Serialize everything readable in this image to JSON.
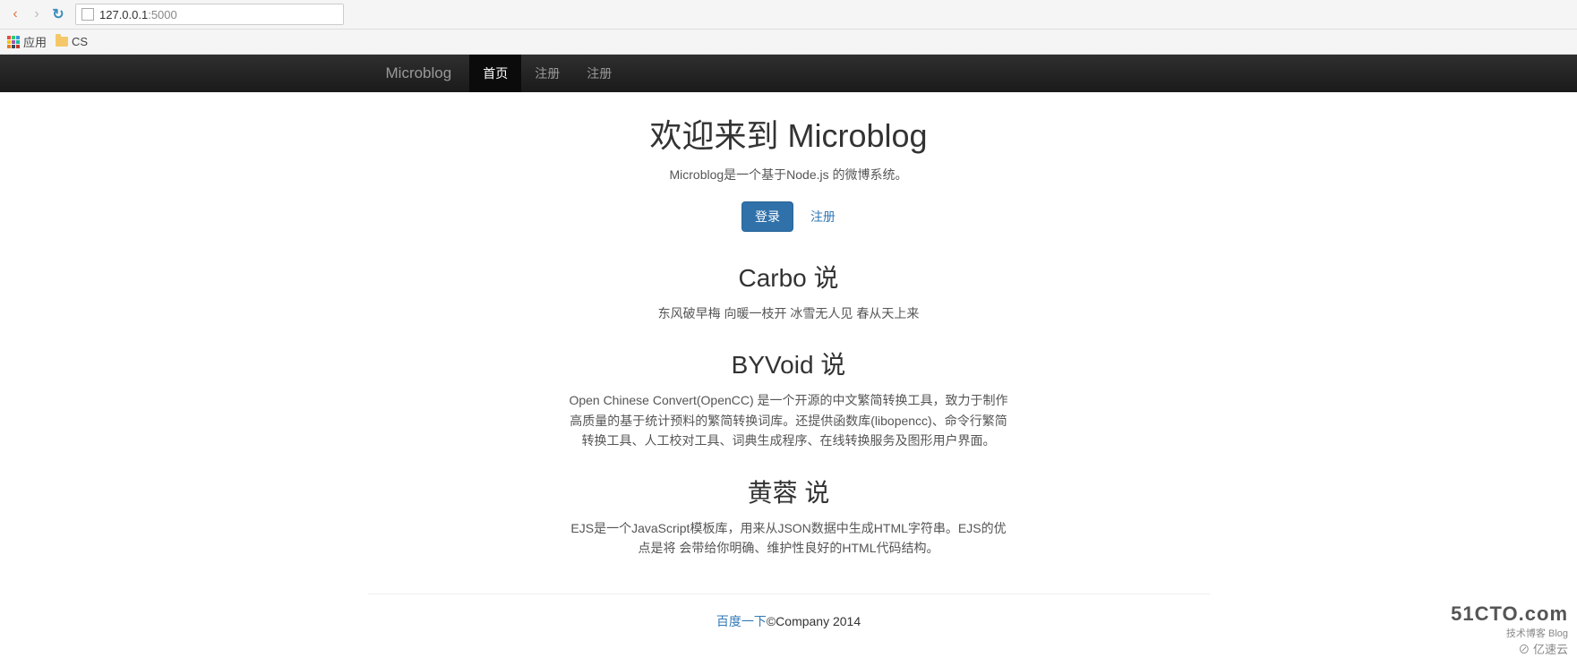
{
  "browser": {
    "url_host": "127.0.0.1",
    "url_port": ":5000",
    "bookmarks": {
      "apps": "应用",
      "cs": "CS"
    }
  },
  "navbar": {
    "brand": "Microblog",
    "links": [
      {
        "label": "首页",
        "active": true
      },
      {
        "label": "注册",
        "active": false
      },
      {
        "label": "注册",
        "active": false
      }
    ]
  },
  "hero": {
    "title": "欢迎来到 Microblog",
    "subtitle": "Microblog是一个基于Node.js 的微博系统。",
    "login_btn": "登录",
    "register_link": "注册"
  },
  "posts": [
    {
      "title": "Carbo 说",
      "body": "东风破早梅 向暖一枝开 冰雪无人见 春从天上来"
    },
    {
      "title": "BYVoid 说",
      "body": "Open Chinese Convert(OpenCC) 是一个开源的中文繁简转换工具，致力于制作高质量的基于统计预料的繁简转换词库。还提供函数库(libopencc)、命令行繁简转换工具、人工校对工具、词典生成程序、在线转换服务及图形用户界面。"
    },
    {
      "title": "黄蓉 说",
      "body": "EJS是一个JavaScript模板库，用来从JSON数据中生成HTML字符串。EJS的优点是将 会带给你明确、维护性良好的HTML代码结构。"
    }
  ],
  "footer": {
    "link": "百度一下",
    "copy": "©Company 2014"
  },
  "watermark": {
    "big": "51CTO.com",
    "sub": "技术博客   Blog",
    "yy": "亿速云"
  }
}
